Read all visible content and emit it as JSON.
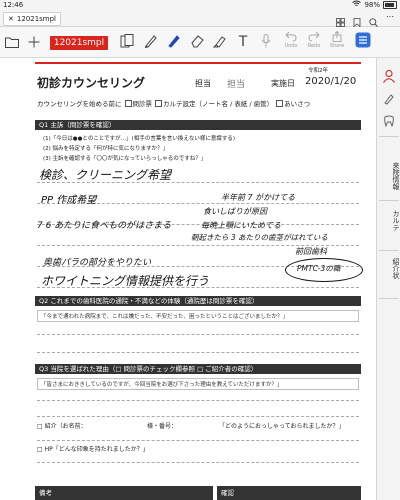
{
  "status_bar": {
    "time": "12:46",
    "battery": "98%"
  },
  "browser_tab": {
    "title": "12021smpl"
  },
  "toolbar": {
    "document_name": "12021smpl",
    "undo_label": "Undo",
    "redo_label": "Redo",
    "share_label": "Share"
  },
  "right_panel": {
    "tabs": [
      "来院情報",
      "カルテ",
      "紹介状"
    ]
  },
  "form": {
    "title": "初診カウンセリング",
    "staff_label": "担当",
    "staff_value": "担当",
    "era": "令和2年",
    "date_label": "実施日",
    "date_value": "2020/1/20",
    "intro_line": "カウンセリングを始める前に",
    "intro_checks": [
      "問診票",
      "カルテ設定（ノート名 / 表紙 / 歯管）",
      "あいさつ"
    ],
    "q1_header": "Q1 主訴（問診票を確認）",
    "q1_items": [
      "(1)「今日は●●とのことですが…」(相手の言葉を言い換えない様に意識する)",
      "(2) 悩みを特定する「何が特に気になりますか？」",
      "(3) 主訴を確認する「〇〇が気になっていらっしゃるのですね？」"
    ],
    "q2_header": "Q2 これまでの歯科医院の通院・不満などの体験（通院歴は問診票を確認）",
    "q2_question": "「今まで通われた病院まで、これは嫌だった、不安だった、困ったということはございましたか？」",
    "q3_header": "Q3 当院を選ばれた理由（□ 問診票のチェック欄参照 □ ご紹介者の確認）",
    "q3_question": "「皆さまにおききしているのですが、今回当院をお選び下さった理由を教えていただけますか？」",
    "referral_label": "□ 紹介（お名前：",
    "referral_number": "様・番号：",
    "referral_question": "「どのようにおっしゃっておられましたか？」",
    "hp_label": "□ HP「どんな印象を持たれましたか？」",
    "remarks_label": "備考",
    "confirm_label": "確認",
    "handwriting": [
      "検診、クリーニング希望",
      "PP 作成希望",
      "7 6 あたりに食べものがはさまる",
      "半年前 7 がかけてる",
      "食いしばりが原因",
      "毎晩上顎にいためてる",
      "朝起きたら 3 あたりの歯茎がはれている",
      "前回歯科",
      "PMTC-3の職",
      "奥歯パラの部分をやりたい",
      "ホワイトニング情報提供を行う"
    ]
  }
}
